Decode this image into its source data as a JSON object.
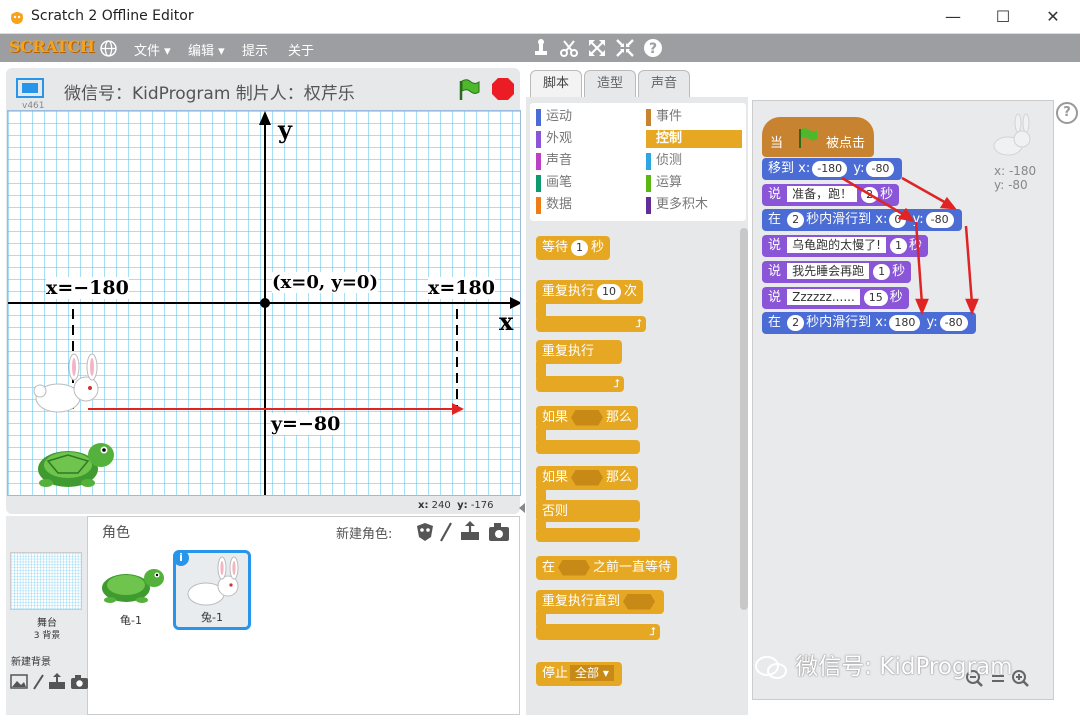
{
  "window": {
    "title": "Scratch 2 Offline Editor",
    "min": "—",
    "max": "☐",
    "close": "✕"
  },
  "menu": {
    "logo": "SCRATCH",
    "items": [
      "文件 ▾",
      "编辑 ▾",
      "提示",
      "关于"
    ]
  },
  "stage": {
    "version": "v461",
    "project_title": "微信号：KidProgram 制片人：权芹乐",
    "axis_y": "y",
    "axis_x": "x",
    "origin_label": "(x=0, y=0)",
    "left_label": "x=−180",
    "right_label": "x=180",
    "ybottom_label": "y=−80",
    "mouse_x_label": "x:",
    "mouse_x": "240",
    "mouse_y_label": "y:",
    "mouse_y": "-176"
  },
  "sprites": {
    "header": "角色",
    "new_sprite": "新建角色:",
    "stage_label": "舞台",
    "stage_backdrops": "3 背景",
    "new_backdrop": "新建背景",
    "list": [
      {
        "name": "龟-1"
      },
      {
        "name": "兔-1",
        "selected": true
      }
    ],
    "info_badge": "i"
  },
  "tabs": [
    "脚本",
    "造型",
    "声音"
  ],
  "categories": {
    "left": [
      {
        "label": "运动",
        "color": "#4a6cd4"
      },
      {
        "label": "外观",
        "color": "#8a55d7"
      },
      {
        "label": "声音",
        "color": "#bb42c3"
      },
      {
        "label": "画笔",
        "color": "#0e9a6c"
      },
      {
        "label": "数据",
        "color": "#ee7d16"
      }
    ],
    "right": [
      {
        "label": "事件",
        "color": "#c88330"
      },
      {
        "label": "控制",
        "color": "#e6a822",
        "active": true
      },
      {
        "label": "侦测",
        "color": "#2ca5e2"
      },
      {
        "label": "运算",
        "color": "#5cb712"
      },
      {
        "label": "更多积木",
        "color": "#632d99"
      }
    ]
  },
  "palette": {
    "wait": "等待",
    "wait_val": "1",
    "wait_unit": "秒",
    "repeat": "重复执行",
    "repeat_val": "10",
    "repeat_unit": "次",
    "forever": "重复执行",
    "if": "如果",
    "then": "那么",
    "if2": "如果",
    "then2": "那么",
    "else": "否则",
    "waituntil_pre": "在",
    "waituntil_post": "之前一直等待",
    "repeatuntil": "重复执行直到",
    "stop": "停止",
    "stop_opt": "全部 ▾"
  },
  "script": {
    "hat_when": "当",
    "hat_clicked": "被点击",
    "goto": {
      "label": "移到 x:",
      "x": "-180",
      "ylabel": "y:",
      "y": "-80"
    },
    "say1": {
      "label": "说",
      "text": "准备，跑！",
      "secs": "2",
      "unit": "秒"
    },
    "glide1": {
      "label": "在",
      "secs": "2",
      "mid": "秒内滑行到 x:",
      "x": "0",
      "ylabel": "y:",
      "y": "-80"
    },
    "say2": {
      "label": "说",
      "text": "乌龟跑的太慢了!",
      "secs": "1",
      "unit": "秒"
    },
    "say3": {
      "label": "说",
      "text": "我先睡会再跑",
      "secs": "1",
      "unit": "秒"
    },
    "say4": {
      "label": "说",
      "text": "Zzzzzz......",
      "secs": "15",
      "unit": "秒"
    },
    "glide2": {
      "label": "在",
      "secs": "2",
      "mid": "秒内滑行到 x:",
      "x": "180",
      "ylabel": "y:",
      "y": "-80"
    },
    "sprite_x": "x: -180",
    "sprite_y": "y: -80",
    "help": "?"
  },
  "watermark": "微信号: KidProgram"
}
